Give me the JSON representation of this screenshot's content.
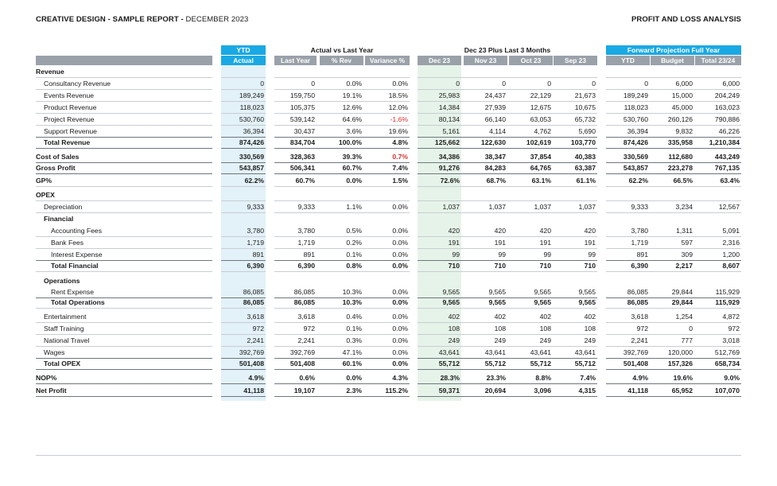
{
  "header": {
    "title": "CREATIVE DESIGN - SAMPLE REPORT -",
    "date": "DECEMBER 2023",
    "right_title": "PROFIT AND LOSS ANALYSIS"
  },
  "group_headers": {
    "ytd": "YTD",
    "actual_vs_last_year": "Actual vs Last Year",
    "dec_plus_3": "Dec 23 Plus Last 3 Months",
    "forward": "Forward Projection Full Year"
  },
  "sub_headers": [
    "Actual",
    "Last Year",
    "% Rev",
    "Variance %",
    "Dec 23",
    "Nov 23",
    "Oct 23",
    "Sep 23",
    "YTD",
    "Budget",
    "Total 23/24"
  ],
  "rows": [
    {
      "label": "Revenue",
      "type": "section",
      "values": []
    },
    {
      "label": "Consultancy Revenue",
      "indent": 1,
      "values": [
        "0",
        "0",
        "0.0%",
        "0.0%",
        "0",
        "0",
        "0",
        "0",
        "0",
        "6,000",
        "6,000"
      ]
    },
    {
      "label": "Events Revenue",
      "indent": 1,
      "values": [
        "189,249",
        "159,750",
        "19.1%",
        "18.5%",
        "25,983",
        "24,437",
        "22,129",
        "21,673",
        "189,249",
        "15,000",
        "204,249"
      ]
    },
    {
      "label": "Product Revenue",
      "indent": 1,
      "values": [
        "118,023",
        "105,375",
        "12.6%",
        "12.0%",
        "14,384",
        "27,939",
        "12,675",
        "10,675",
        "118,023",
        "45,000",
        "163,023"
      ]
    },
    {
      "label": "Project Revenue",
      "indent": 1,
      "values": [
        "530,760",
        "539,142",
        "64.6%",
        "-1.6%",
        "80,134",
        "66,140",
        "63,053",
        "65,732",
        "530,760",
        "260,126",
        "790,886"
      ]
    },
    {
      "label": "Support Revenue",
      "indent": 1,
      "values": [
        "36,394",
        "30,437",
        "3.6%",
        "19.6%",
        "5,161",
        "4,114",
        "4,762",
        "5,690",
        "36,394",
        "9,832",
        "46,226"
      ]
    },
    {
      "label": "Total Revenue",
      "indent": 1,
      "bold": true,
      "values": [
        "874,426",
        "834,704",
        "100.0%",
        "4.8%",
        "125,662",
        "122,630",
        "102,619",
        "103,770",
        "874,426",
        "335,958",
        "1,210,384"
      ]
    },
    {
      "label": "Cost of Sales",
      "indent": 0,
      "bold": true,
      "values": [
        "330,569",
        "328,363",
        "39.3%",
        "0.7%",
        "34,386",
        "38,347",
        "37,854",
        "40,383",
        "330,569",
        "112,680",
        "443,249"
      ]
    },
    {
      "label": "Gross Profit",
      "indent": 0,
      "bold": true,
      "values": [
        "543,857",
        "506,341",
        "60.7%",
        "7.4%",
        "91,276",
        "84,283",
        "64,765",
        "63,387",
        "543,857",
        "223,278",
        "767,135"
      ]
    },
    {
      "label": "GP%",
      "indent": 0,
      "bold": true,
      "values": [
        "62.2%",
        "60.7%",
        "0.0%",
        "1.5%",
        "72.6%",
        "68.7%",
        "63.1%",
        "61.1%",
        "62.2%",
        "66.5%",
        "63.4%"
      ]
    },
    {
      "label": "OPEX",
      "type": "section",
      "values": []
    },
    {
      "label": "Depreciation",
      "indent": 1,
      "values": [
        "9,333",
        "9,333",
        "1.1%",
        "0.0%",
        "1,037",
        "1,037",
        "1,037",
        "1,037",
        "9,333",
        "3,234",
        "12,567"
      ]
    },
    {
      "label": "Financial",
      "indent": 1,
      "type": "subsection",
      "values": []
    },
    {
      "label": "Accounting Fees",
      "indent": 2,
      "values": [
        "3,780",
        "3,780",
        "0.5%",
        "0.0%",
        "420",
        "420",
        "420",
        "420",
        "3,780",
        "1,311",
        "5,091"
      ]
    },
    {
      "label": "Bank Fees",
      "indent": 2,
      "values": [
        "1,719",
        "1,719",
        "0.2%",
        "0.0%",
        "191",
        "191",
        "191",
        "191",
        "1,719",
        "597",
        "2,316"
      ]
    },
    {
      "label": "Interest Expense",
      "indent": 2,
      "values": [
        "891",
        "891",
        "0.1%",
        "0.0%",
        "99",
        "99",
        "99",
        "99",
        "891",
        "309",
        "1,200"
      ]
    },
    {
      "label": "Total Financial",
      "indent": 2,
      "bold": true,
      "values": [
        "6,390",
        "6,390",
        "0.8%",
        "0.0%",
        "710",
        "710",
        "710",
        "710",
        "6,390",
        "2,217",
        "8,607"
      ]
    },
    {
      "label": "Operations",
      "indent": 1,
      "type": "subsection",
      "values": []
    },
    {
      "label": "Rent Expense",
      "indent": 2,
      "values": [
        "86,085",
        "86,085",
        "10.3%",
        "0.0%",
        "9,565",
        "9,565",
        "9,565",
        "9,565",
        "86,085",
        "29,844",
        "115,929"
      ]
    },
    {
      "label": "Total Operations",
      "indent": 2,
      "bold": true,
      "values": [
        "86,085",
        "86,085",
        "10.3%",
        "0.0%",
        "9,565",
        "9,565",
        "9,565",
        "9,565",
        "86,085",
        "29,844",
        "115,929"
      ]
    },
    {
      "label": "Entertainment",
      "indent": 1,
      "values": [
        "3,618",
        "3,618",
        "0.4%",
        "0.0%",
        "402",
        "402",
        "402",
        "402",
        "3,618",
        "1,254",
        "4,872"
      ]
    },
    {
      "label": "Staff Training",
      "indent": 1,
      "values": [
        "972",
        "972",
        "0.1%",
        "0.0%",
        "108",
        "108",
        "108",
        "108",
        "972",
        "0",
        "972"
      ]
    },
    {
      "label": "National Travel",
      "indent": 1,
      "values": [
        "2,241",
        "2,241",
        "0.3%",
        "0.0%",
        "249",
        "249",
        "249",
        "249",
        "2,241",
        "777",
        "3,018"
      ]
    },
    {
      "label": "Wages",
      "indent": 1,
      "values": [
        "392,769",
        "392,769",
        "47.1%",
        "0.0%",
        "43,641",
        "43,641",
        "43,641",
        "43,641",
        "392,769",
        "120,000",
        "512,769"
      ]
    },
    {
      "label": "Total OPEX",
      "indent": 1,
      "bold": true,
      "values": [
        "501,408",
        "501,408",
        "60.1%",
        "0.0%",
        "55,712",
        "55,712",
        "55,712",
        "55,712",
        "501,408",
        "157,326",
        "658,734"
      ]
    },
    {
      "label": "NOP%",
      "indent": 0,
      "bold": true,
      "values": [
        "4.9%",
        "0.6%",
        "0.0%",
        "4.3%",
        "28.3%",
        "23.3%",
        "8.8%",
        "7.4%",
        "4.9%",
        "19.6%",
        "9.0%"
      ]
    },
    {
      "label": "Net Profit",
      "indent": 0,
      "bold": true,
      "values": [
        "41,118",
        "19,107",
        "2.3%",
        "115.2%",
        "59,371",
        "20,694",
        "3,096",
        "4,315",
        "41,118",
        "65,952",
        "107,070"
      ]
    }
  ],
  "colors": {
    "accent_blue": "#1aa9e3",
    "header_grey": "#9aa1a9",
    "ytd_band": "#e3f1f8",
    "dec_band": "#e6f3e9",
    "negative": "#d6302a"
  }
}
